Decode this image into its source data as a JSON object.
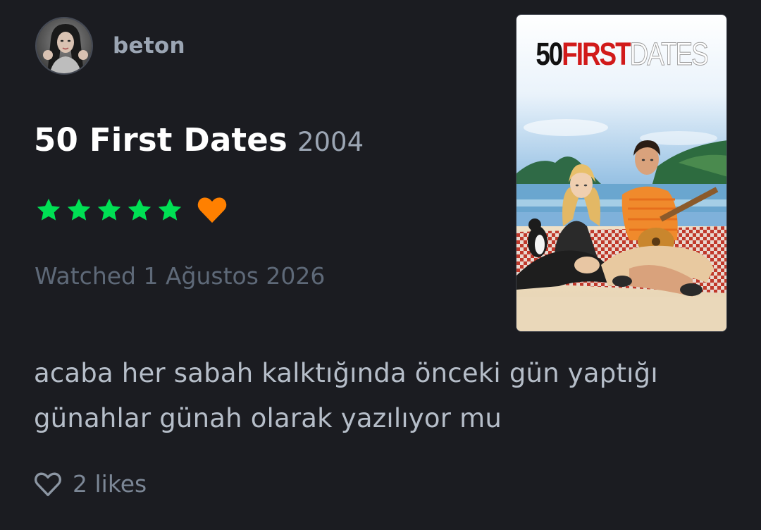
{
  "user": {
    "name": "beton",
    "avatar_icon": "profile-photo"
  },
  "film": {
    "title": "50 First Dates",
    "year": "2004"
  },
  "rating": {
    "stars": 5,
    "max_stars": 5,
    "star_color": "#00e054",
    "liked": true,
    "like_color": "#ff8000"
  },
  "watched_label": "Watched 1 Ağustos 2026",
  "poster": {
    "title_part1": "50",
    "title_part2": "FIRST",
    "title_part3": "DATES"
  },
  "review": {
    "line1": "acaba her sabah kalktığında önceki gün yaptığı",
    "line2": "günahlar günah olarak yazılıyor mu"
  },
  "likes": {
    "count_label": "2 likes",
    "icon": "heart-outline-icon"
  }
}
